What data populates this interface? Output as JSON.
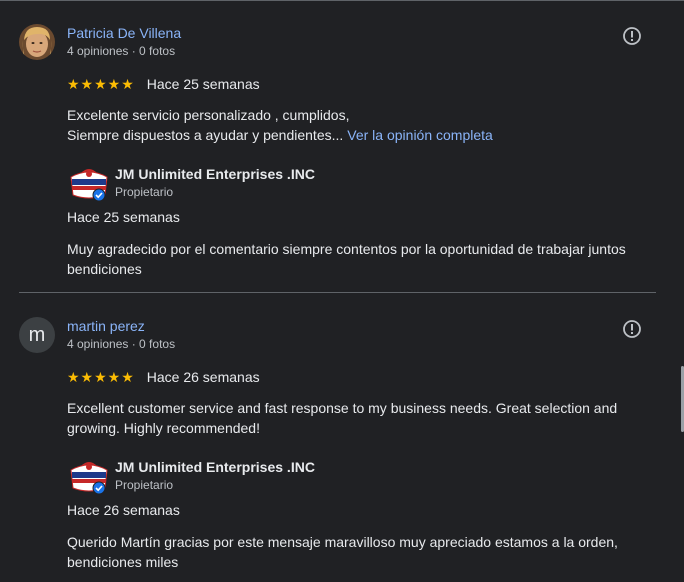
{
  "reviews": [
    {
      "name": "Patricia De Villena",
      "meta": "4 opiniones · 0 fotos",
      "stars": "★★★★★",
      "rating": 5,
      "ago": "Hace 25 semanas",
      "text_line1": "Excelente servicio personalizado , cumplidos,",
      "text_line2": "Siempre dispuestos a ayudar y pendientes...",
      "more_link": "Ver la opinión completa",
      "owner_name": "JM Unlimited Enterprises .INC",
      "owner_role": "Propietario",
      "owner_ago": "Hace 25 semanas",
      "owner_reply": "Muy agradecido por el comentario siempre contentos por la oportunidad de trabajar juntos bendiciones"
    },
    {
      "avatar_letter": "m",
      "name": "martin perez",
      "meta": "4 opiniones · 0 fotos",
      "stars": "★★★★★",
      "rating": 5,
      "ago": "Hace 26 semanas",
      "text": "Excellent customer service and fast response to my business needs. Great selection and growing. Highly recommended!",
      "owner_name": "JM Unlimited Enterprises .INC",
      "owner_role": "Propietario",
      "owner_ago": "Hace 26 semanas",
      "owner_reply": "Querido Martín gracias por este mensaje maravilloso muy apreciado estamos a la orden, bendiciones miles"
    }
  ],
  "colors": {
    "background": "#202124",
    "link": "#8ab4f8",
    "star": "#fbbc04",
    "verified": "#1a73e8",
    "avatar_bg": "#3c4043"
  },
  "icons": [
    "report-flag-icon",
    "verified-badge-icon",
    "business-logo"
  ]
}
